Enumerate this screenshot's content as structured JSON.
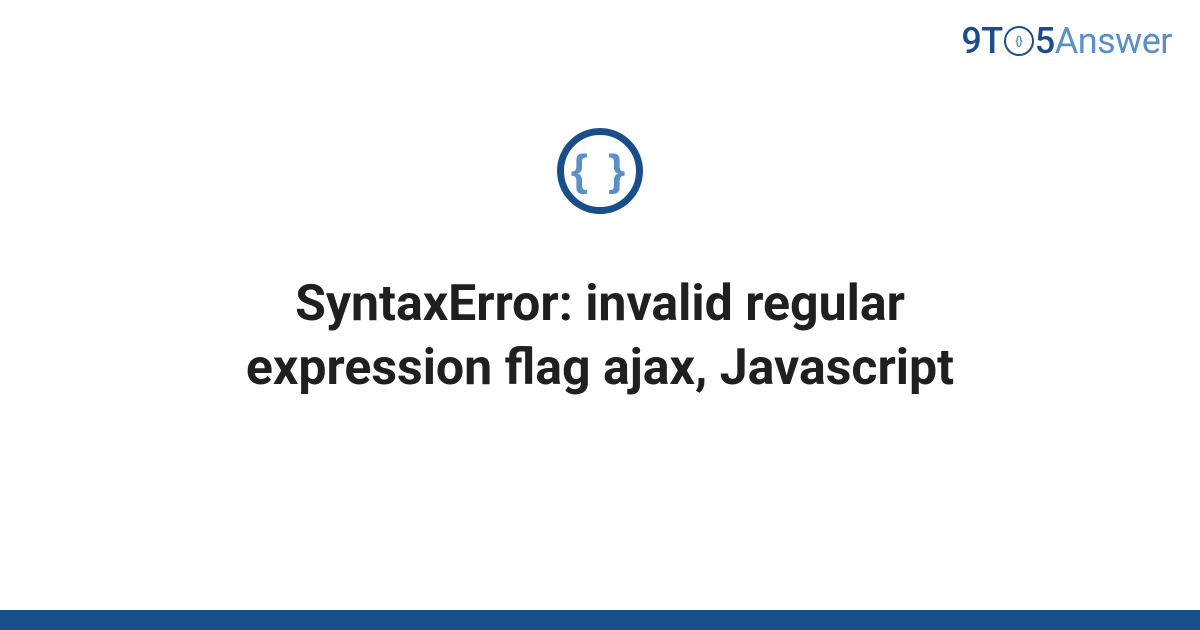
{
  "logo": {
    "part1": "9T",
    "clock_inner": "{}",
    "part2": "5",
    "part3": "Answer"
  },
  "icon": {
    "name": "code-braces-icon",
    "glyph": "{ }"
  },
  "title": "SyntaxError: invalid regular expression flag ajax, Javascript",
  "colors": {
    "primary": "#1a4e8a",
    "accent": "#5b8fc7",
    "text": "#1f1f1f"
  }
}
